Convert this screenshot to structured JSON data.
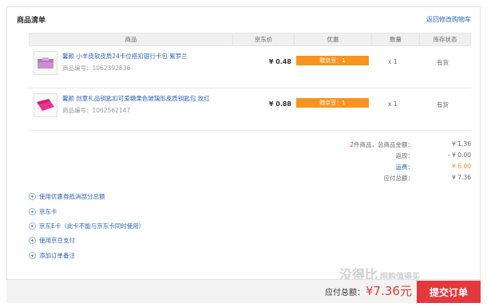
{
  "section": {
    "title": "商品清单",
    "back_link": "返回修改购物车"
  },
  "table": {
    "headers": [
      "商品",
      "京东价",
      "优惠",
      "数量",
      "库存状态"
    ]
  },
  "items": [
    {
      "name": "馨颜 小羊皮软皮质24卡位搭扣银行卡包 紫罗兰",
      "id_label": "商品编号：1062392836",
      "price": "¥ 0.48",
      "discount": "赠京豆：1",
      "qty": "x 1",
      "stock": "有货",
      "thumb_color": "#c98fd0"
    },
    {
      "name": "馨颜 创意礼品钥匙扣可爱糖果色玻璃形皮质钥匙包 玫红",
      "id_label": "商品编号：1062562147",
      "price": "¥ 0.88",
      "discount": "赠京豆：1",
      "qty": "x 1",
      "stock": "有货",
      "thumb_color": "#e8338a"
    }
  ],
  "summary": {
    "count_num": "2",
    "count_text": "件商品，总商品金额：",
    "total_goods": "¥ 1.36",
    "rebate_label": "返现：",
    "rebate": "- ¥ 0.00",
    "shipping_label": "运费：",
    "shipping": "¥ 6.00",
    "payable_label": "应付总额：",
    "payable": "¥ 7.36"
  },
  "options": [
    "使用优惠券抵消部分总额",
    "京东卡",
    "京东E卡（此卡不能与京东卡同时使用）",
    "使用京豆支付",
    "添加订单备注"
  ],
  "footer": {
    "total_label": "应付总额：",
    "total": "¥7.36元",
    "submit": "提交订单",
    "watermark": "没得比",
    "watermark_sub": "网购值得买"
  },
  "colors": {
    "accent": "#e4393c",
    "link": "#2b64b3",
    "badge": "#f7941d"
  }
}
